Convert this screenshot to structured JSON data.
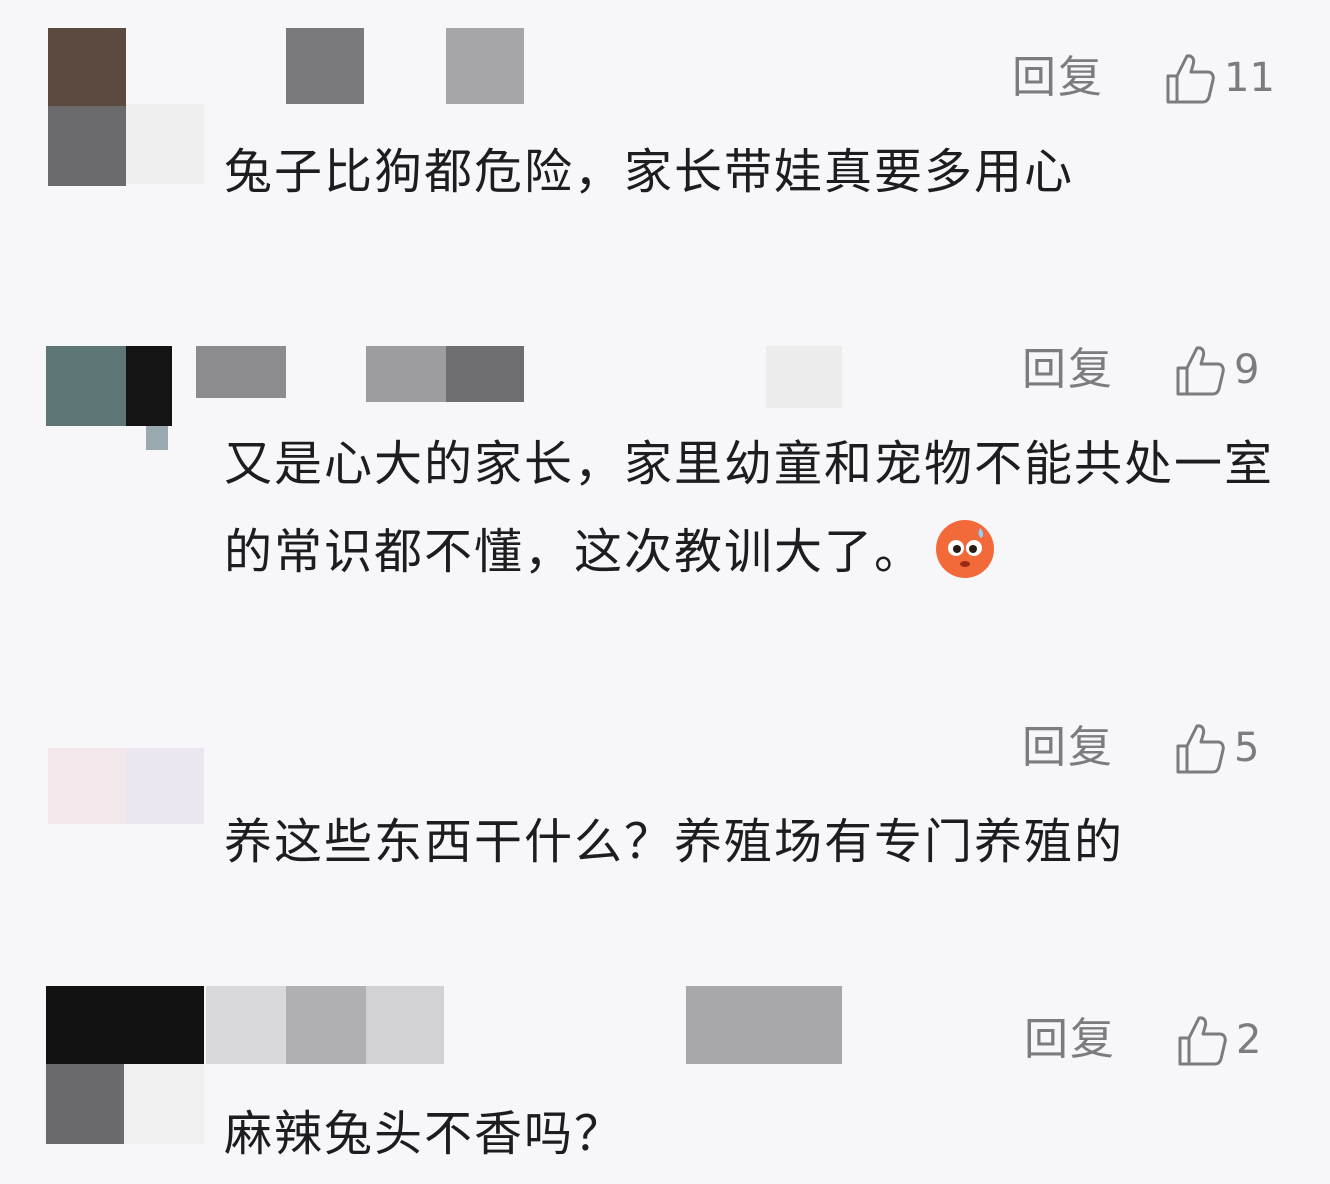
{
  "labels": {
    "reply": "回复"
  },
  "comments": [
    {
      "likes": "11",
      "text": "兔子比狗都危险，家长带娃真要多用心"
    },
    {
      "likes": "9",
      "text": "又是心大的家长，家里幼童和宠物不能共处一室的常识都不懂，这次教训大了。",
      "emoji": "scared-emoji-icon"
    },
    {
      "likes": "5",
      "text": "养这些东西干什么？养殖场有专门养殖的"
    },
    {
      "likes": "2",
      "text": "麻辣兔头不香吗？"
    }
  ],
  "colors": {
    "background": "#f7f7f9",
    "text": "#1d1d1f",
    "muted": "#7c7c80"
  }
}
